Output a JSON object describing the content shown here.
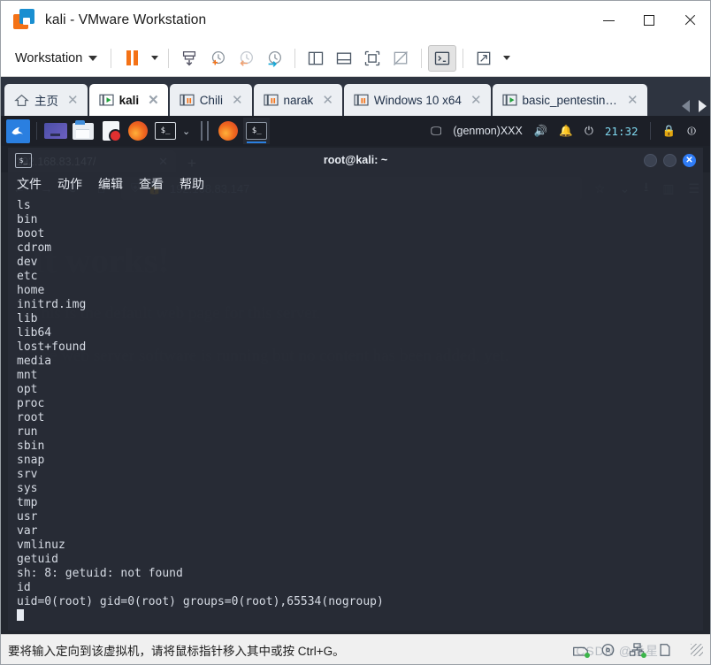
{
  "window": {
    "title": "kali - VMware Workstation",
    "logo_icon": "vmware-logo-icon",
    "minimize_label": "minimize",
    "maximize_label": "maximize",
    "close_label": "close"
  },
  "toolbar": {
    "menu_label": "Workstation",
    "buttons": [
      {
        "name": "suspend-button",
        "icon": "pause-icon"
      },
      {
        "name": "power-dropdown",
        "icon": "chevron-down-icon"
      },
      {
        "name": "snapshot-manager-button",
        "icon": "snapshot-icon"
      },
      {
        "name": "take-snapshot-button",
        "icon": "clock-plus-icon"
      },
      {
        "name": "revert-snapshot-button",
        "icon": "clock-back-icon"
      },
      {
        "name": "manage-snapshots-button",
        "icon": "clock-wrench-icon"
      },
      {
        "name": "show-library-button",
        "icon": "panel-left-icon"
      },
      {
        "name": "show-thumbnail-bar-button",
        "icon": "panel-bottom-icon"
      },
      {
        "name": "fullscreen-button",
        "icon": "fullscreen-icon"
      },
      {
        "name": "unity-mode-button",
        "icon": "unity-off-icon"
      },
      {
        "name": "console-view-button",
        "icon": "console-icon"
      },
      {
        "name": "stretch-view-button",
        "icon": "expand-arrows-icon"
      },
      {
        "name": "view-dropdown",
        "icon": "chevron-down-icon"
      }
    ]
  },
  "tabs": {
    "items": [
      {
        "label": "主页",
        "icon": "home-icon",
        "state": "home",
        "active": false
      },
      {
        "label": "kali",
        "icon": "vm-running-icon",
        "state": "running",
        "active": true
      },
      {
        "label": "Chili",
        "icon": "vm-suspended-icon",
        "state": "suspended",
        "active": false
      },
      {
        "label": "narak",
        "icon": "vm-suspended-icon",
        "state": "suspended",
        "active": false
      },
      {
        "label": "Windows 10 x64",
        "icon": "vm-suspended-icon",
        "state": "suspended",
        "active": false
      },
      {
        "label": "basic_pentesting...",
        "icon": "vm-running-icon",
        "state": "running",
        "active": false
      }
    ],
    "close_glyph": "✕",
    "scroll_left": "scroll-tabs-left",
    "scroll_right": "scroll-tabs-right"
  },
  "kali_panel": {
    "app_menu_icon": "kali-dragon-icon",
    "launchers": [
      {
        "name": "workspace-switcher",
        "icon": "workspace-icon"
      },
      {
        "name": "file-manager-launcher",
        "icon": "folder-icon"
      },
      {
        "name": "text-editor-launcher",
        "icon": "document-icon"
      },
      {
        "name": "firefox-launcher",
        "icon": "firefox-icon"
      },
      {
        "name": "terminal-launcher",
        "icon": "terminal-icon"
      }
    ],
    "terminal_glyph": "$_",
    "tray": {
      "display_icon": "display-icon",
      "genmon_text": "(genmon)XXX",
      "volume_icon": "volume-icon",
      "notification_icon": "bell-icon",
      "power_icon": "power-icon",
      "clock": "21:32",
      "lock_icon": "lock-icon",
      "logout_icon": "logout-icon"
    }
  },
  "firefox": {
    "tab_title": "",
    "url": "192.168.83.147",
    "url_path": "192.168.83.147/",
    "shield_icon": "shield-icon",
    "lock_icon": "lock-icon",
    "back_icon": "back-arrow-icon",
    "forward_icon": "forward-arrow-icon",
    "reload_icon": "reload-icon",
    "home_icon": "home-icon",
    "bookmark_icon": "star-icon",
    "pocket_icon": "pocket-icon",
    "downloads_icon": "download-icon",
    "extension_icon": "extension-icon",
    "menu_icon": "hamburger-menu-icon",
    "new_tab_glyph": "+",
    "page": {
      "heading": "It works!",
      "paragraph1": "This is the default web page for this server.",
      "paragraph2": "The web server software is running but no content has been added, yet."
    }
  },
  "terminal": {
    "title": "root@kali: ~",
    "icon": "terminal-icon",
    "icon_glyph": "$_",
    "menus": [
      "文件",
      "动作",
      "编辑",
      "查看",
      "帮助"
    ],
    "controls": {
      "minimize": "minimize",
      "maximize": "maximize",
      "close": "✕"
    },
    "output": "ls\nbin\nboot\ncdrom\ndev\netc\nhome\ninitrd.img\nlib\nlib64\nlost+found\nmedia\nmnt\nopt\nproc\nroot\nrun\nsbin\nsnap\nsrv\nsys\ntmp\nusr\nvar\nvmlinuz\ngetuid\nsh: 8: getuid: not found\nid\nuid=0(root) gid=0(root) groups=0(root),65534(nogroup)\n"
  },
  "statusbar": {
    "message": "要将输入定向到该虚拟机，请将鼠标指针移入其中或按 Ctrl+G。",
    "devices": [
      {
        "name": "hard-disk-icon",
        "active": true
      },
      {
        "name": "cd-dvd-icon",
        "active": false
      },
      {
        "name": "network-adapter-icon",
        "active": true
      },
      {
        "name": "usb-device-icon",
        "active": false
      }
    ],
    "watermark": "CSDN @逢星"
  },
  "colors": {
    "accent_orange": "#f47216",
    "accent_blue": "#1a8fd1",
    "tabbar_bg": "#2e3440",
    "running_green": "#3cb54a",
    "close_blue": "#2f7cf6"
  }
}
